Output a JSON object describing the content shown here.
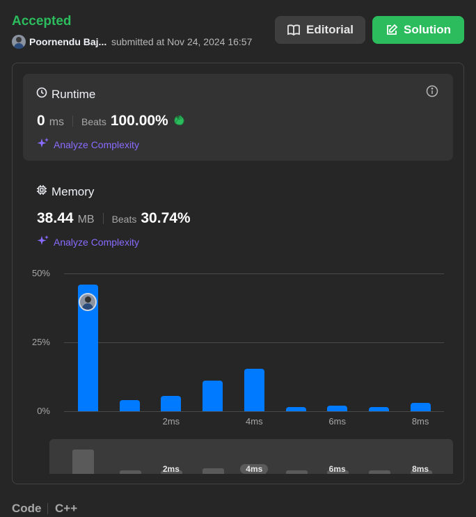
{
  "header": {
    "status": "Accepted",
    "author": "Poornendu Baj...",
    "submitted": "submitted at Nov 24, 2024 16:57",
    "editorial_label": "Editorial",
    "solution_label": "Solution"
  },
  "runtime": {
    "title": "Runtime",
    "value": "0",
    "unit": "ms",
    "beats_label": "Beats",
    "beats_value": "100.00%",
    "analyze_label": "Analyze Complexity"
  },
  "memory": {
    "title": "Memory",
    "value": "38.44",
    "unit": "MB",
    "beats_label": "Beats",
    "beats_value": "30.74%",
    "analyze_label": "Analyze Complexity"
  },
  "footer": {
    "code_label": "Code",
    "language": "C++"
  },
  "colors": {
    "accepted": "#2cbb5d",
    "bar": "#007aff",
    "analyze": "#8a6bff"
  },
  "chart_data": {
    "type": "bar",
    "y_tick_labels": [
      "50%",
      "25%",
      "0%"
    ],
    "x_tick_labels": [
      "2ms",
      "4ms",
      "6ms",
      "8ms"
    ],
    "ylim": [
      0,
      50
    ],
    "values": [
      46,
      4,
      5.5,
      11,
      15.5,
      1.5,
      2,
      1.5,
      3
    ],
    "highlight_index": 0,
    "grid": true
  }
}
